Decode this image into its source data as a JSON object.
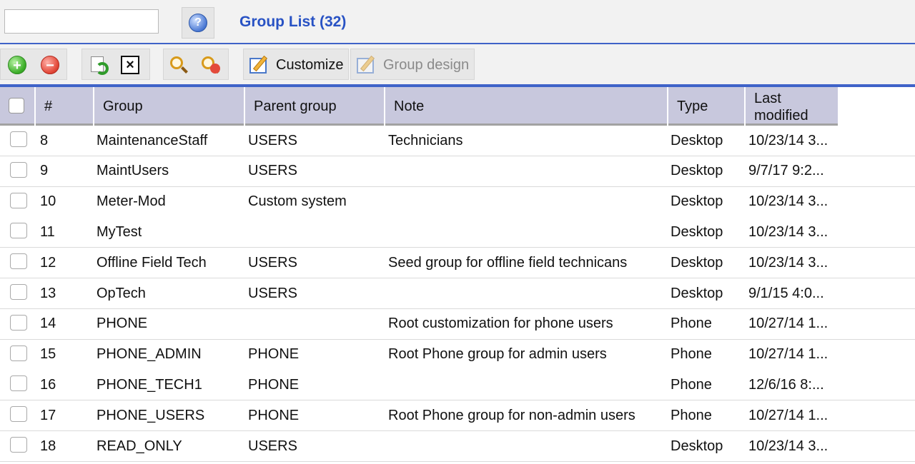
{
  "header": {
    "search_value": "",
    "help_icon": "question-circle-icon",
    "title": "Group List (32)"
  },
  "toolbar": {
    "buttons": [
      {
        "name": "add-button",
        "icon": "plus-circle-icon"
      },
      {
        "name": "remove-button",
        "icon": "minus-circle-icon"
      },
      {
        "name": "refresh-button",
        "icon": "refresh-page-icon"
      },
      {
        "name": "clear-button",
        "icon": "close-box-icon"
      },
      {
        "name": "search-button",
        "icon": "magnifier-icon"
      },
      {
        "name": "clear-search-button",
        "icon": "magnifier-minus-icon"
      }
    ],
    "customize_label": "Customize",
    "group_design_label": "Group design"
  },
  "table": {
    "columns": [
      "#",
      "Group",
      "Parent group",
      "Note",
      "Type",
      "Last modified"
    ],
    "column_type_second_line": "modified",
    "rows": [
      {
        "id": "8",
        "group": "MaintenanceStaff",
        "parent": "USERS",
        "note": "Technicians",
        "type": "Desktop",
        "modified": "10/23/14 3..."
      },
      {
        "id": "9",
        "group": "MaintUsers",
        "parent": "USERS",
        "note": "",
        "type": "Desktop",
        "modified": "9/7/17 9:2..."
      },
      {
        "id": "10",
        "group": "Meter-Mod",
        "parent": "Custom system",
        "note": "",
        "type": "Desktop",
        "modified": "10/23/14 3..."
      },
      {
        "id": "11",
        "group": "MyTest",
        "parent": "",
        "note": "",
        "type": "Desktop",
        "modified": "10/23/14 3..."
      },
      {
        "id": "12",
        "group": "Offline Field Tech",
        "parent": "USERS",
        "note": "Seed group for offline field technicans",
        "type": "Desktop",
        "modified": "10/23/14 3..."
      },
      {
        "id": "13",
        "group": "OpTech",
        "parent": "USERS",
        "note": "",
        "type": "Desktop",
        "modified": "9/1/15 4:0..."
      },
      {
        "id": "14",
        "group": "PHONE",
        "parent": "",
        "note": "Root customization for phone users",
        "type": "Phone",
        "modified": "10/27/14 1..."
      },
      {
        "id": "15",
        "group": "PHONE_ADMIN",
        "parent": "PHONE",
        "note": "Root Phone group for admin users",
        "type": "Phone",
        "modified": "10/27/14 1..."
      },
      {
        "id": "16",
        "group": "PHONE_TECH1",
        "parent": "PHONE",
        "note": "",
        "type": "Phone",
        "modified": "12/6/16 8:..."
      },
      {
        "id": "17",
        "group": "PHONE_USERS",
        "parent": "PHONE",
        "note": "Root Phone group for non-admin users",
        "type": "Phone",
        "modified": "10/27/14 1..."
      },
      {
        "id": "18",
        "group": "READ_ONLY",
        "parent": "USERS",
        "note": "",
        "type": "Desktop",
        "modified": "10/23/14 3..."
      }
    ]
  },
  "colors": {
    "accent": "#2852c4",
    "header_bar": "#c8c8dd"
  }
}
